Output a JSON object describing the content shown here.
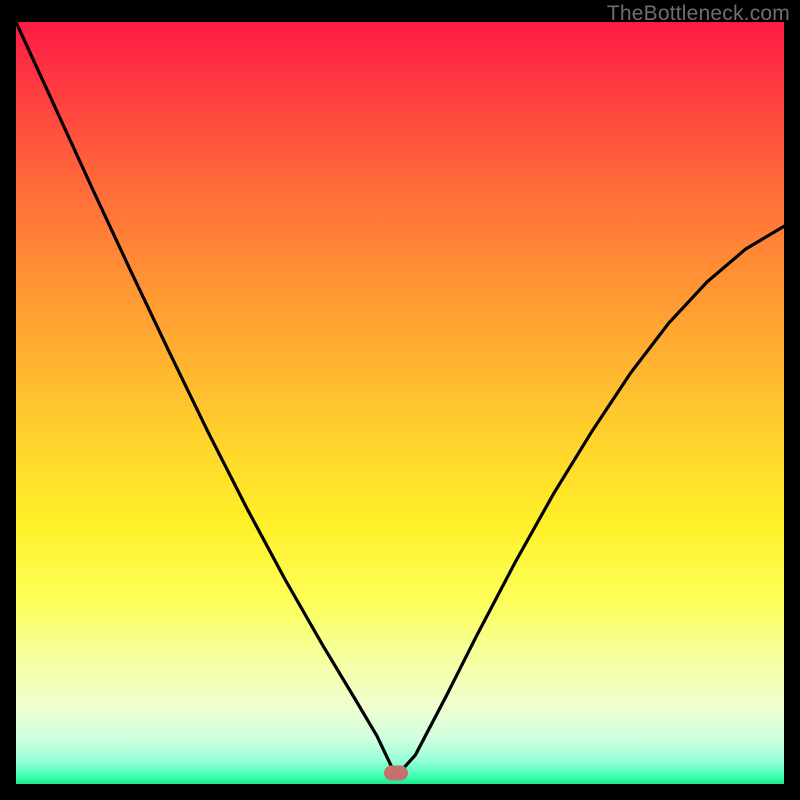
{
  "watermark": "TheBottleneck.com",
  "marker": {
    "x_frac": 0.495,
    "y_frac": 0.985
  },
  "colors": {
    "curve": "#000000",
    "marker": "#c5716e",
    "gradient_top": "#fe1a46",
    "gradient_bottom": "#18e890"
  },
  "chart_data": {
    "type": "line",
    "title": "",
    "xlabel": "",
    "ylabel": "",
    "xlim": [
      0,
      1
    ],
    "ylim": [
      0,
      1
    ],
    "note": "V-shaped bottleneck curve over vertical red→green gradient. Left branch descends from top-left to a minimum near x≈0.495, right branch rises to ~0.73 at x=1. Background color encodes value (red=high, green=low). No axis ticks or labels visible.",
    "series": [
      {
        "name": "bottleneck-curve",
        "x": [
          0.0,
          0.05,
          0.1,
          0.15,
          0.2,
          0.25,
          0.3,
          0.35,
          0.4,
          0.44,
          0.47,
          0.495,
          0.52,
          0.56,
          0.6,
          0.65,
          0.7,
          0.75,
          0.8,
          0.85,
          0.9,
          0.95,
          1.0
        ],
        "values": [
          1.0,
          0.89,
          0.78,
          0.672,
          0.566,
          0.462,
          0.363,
          0.269,
          0.181,
          0.114,
          0.063,
          0.01,
          0.038,
          0.115,
          0.195,
          0.291,
          0.381,
          0.463,
          0.539,
          0.605,
          0.659,
          0.702,
          0.732
        ]
      }
    ],
    "annotations": [
      {
        "name": "min-marker",
        "x": 0.495,
        "y": 0.015
      }
    ]
  }
}
